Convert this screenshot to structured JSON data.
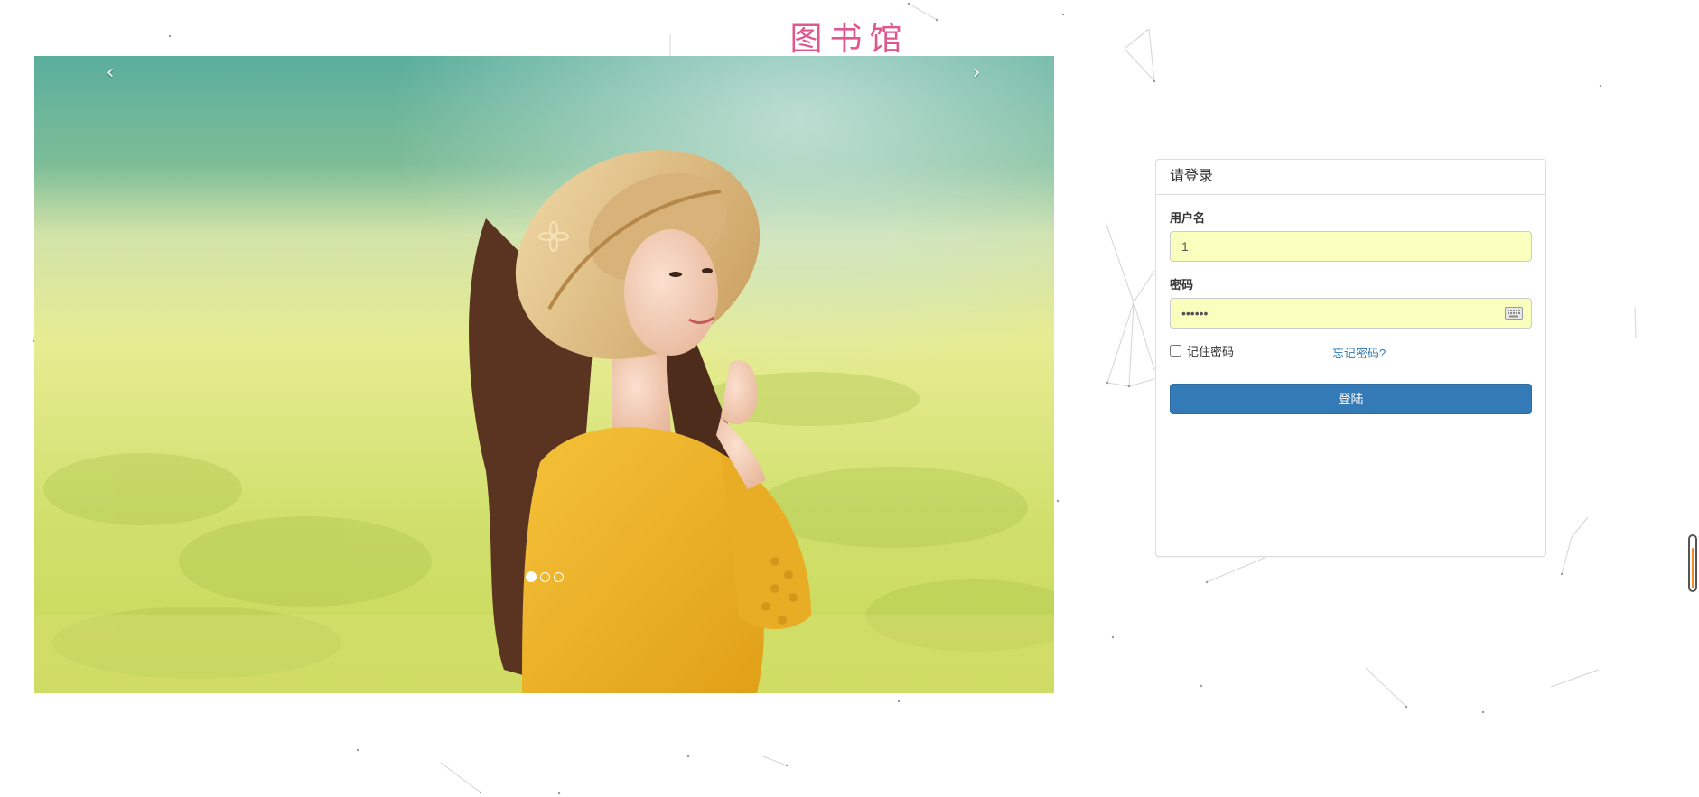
{
  "site": {
    "title": "图书馆"
  },
  "carousel": {
    "prev_label": "‹",
    "next_label": "›",
    "slide_count": 3,
    "active_index": 0
  },
  "login": {
    "heading": "请登录",
    "username_label": "用户名",
    "username_value": "1",
    "password_label": "密码",
    "password_value": "123456",
    "remember_label": "记住密码",
    "remember_checked": false,
    "forgot_label": "忘记密码?",
    "submit_label": "登陆"
  },
  "scroll": {
    "progress": 0.75
  },
  "colors": {
    "title": "#e0578f",
    "primary": "#337ab7",
    "autofill": "#faffbd",
    "scroll_fill": "#f08a24"
  }
}
